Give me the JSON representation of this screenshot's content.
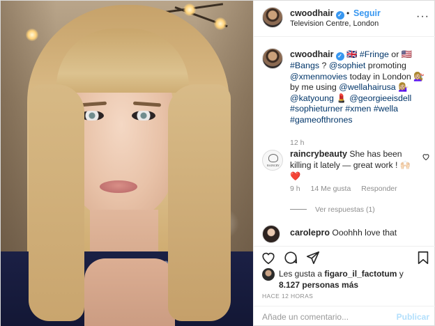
{
  "header": {
    "username": "cwoodhair",
    "separator": "•",
    "follow_label": "Seguir",
    "location": "Television Centre, London",
    "more_label": "···"
  },
  "caption": {
    "username": "cwoodhair",
    "parts": [
      " 🇬🇧 ",
      "#Fringe",
      " or 🇺🇸 ",
      "#Bangs",
      " ? ",
      "@sophiet",
      " promoting ",
      "@xmenmovies",
      " today in London 💇🏼‍♀️ by me using ",
      "@wellahairusa",
      " 💁🏼‍♀️ ",
      "@katyoung",
      " 💄 ",
      "@georgieeisdell",
      " ",
      "#sophieturner",
      " ",
      "#xmen",
      " ",
      "#wella",
      " ",
      "#gameofthrones"
    ],
    "time": "12 h"
  },
  "comment1": {
    "username": "raincrybeauty",
    "avatar_text": "RAINCRY",
    "text": " She has been killing it lately — great work ! 🙌🏻❤️",
    "time": "9 h",
    "likes": "14 Me gusta",
    "reply": "Responder",
    "view_replies": "Ver respuestas (1)"
  },
  "comment2": {
    "username": "carolepro",
    "text": " Ooohhh love that"
  },
  "likes": {
    "text_prefix": "Les gusta a ",
    "liker": "figaro_il_factotum",
    "text_mid": " y ",
    "count": "8.127 personas más"
  },
  "timestamp": "HACE 12 HORAS",
  "add_comment": {
    "placeholder": "Añade un comentario...",
    "publish_label": "Publicar"
  },
  "colors": {
    "link_blue": "#3897f0",
    "tag_color": "#003569",
    "muted": "#8e8e8e",
    "publish_disabled": "#b2dffc"
  },
  "icons": [
    "heart-icon",
    "comment-icon",
    "share-icon",
    "bookmark-icon",
    "verified-icon",
    "more-icon"
  ]
}
